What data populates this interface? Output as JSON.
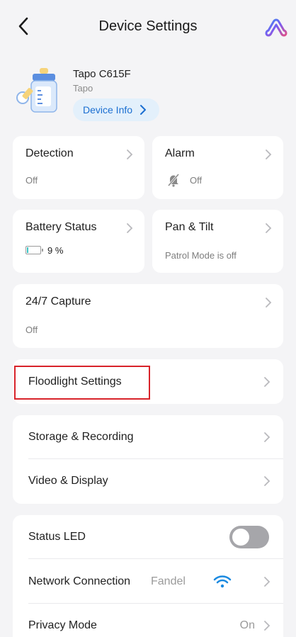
{
  "header": {
    "title": "Device Settings",
    "back_icon": "chevron-left-icon",
    "logo_icon": "tapo-logo-icon"
  },
  "device": {
    "name": "Tapo C615F",
    "brand": "Tapo",
    "info_button": "Device Info"
  },
  "cards": {
    "detection": {
      "title": "Detection",
      "status": "Off"
    },
    "alarm": {
      "title": "Alarm",
      "status": "Off",
      "icon": "alarm-off-icon"
    },
    "battery": {
      "title": "Battery Status",
      "level_text": "9 %",
      "level": 0.09,
      "fill_color": "#3cc4c4"
    },
    "pan_tilt": {
      "title": "Pan & Tilt",
      "status": "Patrol Mode is off"
    },
    "capture": {
      "title": "24/7 Capture",
      "status": "Off"
    }
  },
  "floodlight": {
    "label": "Floodlight Settings"
  },
  "storage_group": {
    "storage_label": "Storage & Recording",
    "video_label": "Video & Display"
  },
  "network_group": {
    "status_led_label": "Status LED",
    "status_led_on": false,
    "network_label": "Network Connection",
    "network_value": "Fandel",
    "privacy_label": "Privacy Mode",
    "privacy_value": "On"
  },
  "colors": {
    "accent": "#1b6fd1",
    "highlight": "#d8232a",
    "wifi": "#1b8ae0"
  }
}
